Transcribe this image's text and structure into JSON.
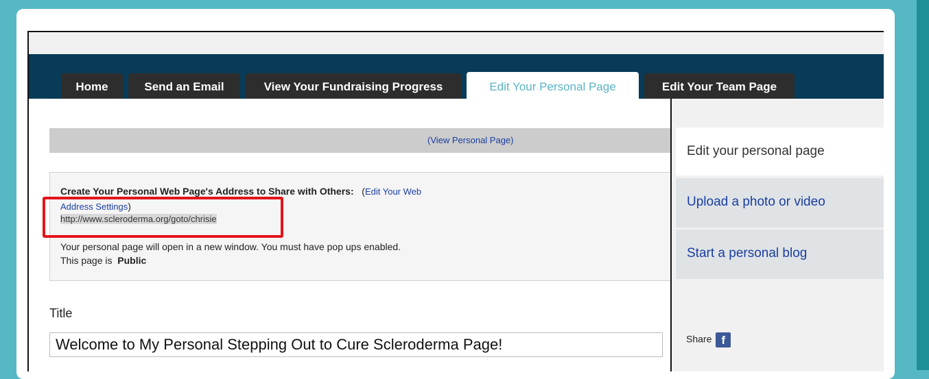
{
  "tabs": [
    {
      "label": "Home"
    },
    {
      "label": "Send an Email"
    },
    {
      "label": "View Your Fundraising Progress"
    },
    {
      "label": "Edit Your Personal Page"
    },
    {
      "label": "Edit Your Team Page"
    }
  ],
  "view_personal_page": "(View Personal Page)",
  "info": {
    "heading": "Create Your Personal Web Page's Address to Share with Others:",
    "paren_open": "(",
    "edit_link_part1": "Edit Your Web",
    "edit_link_part2": "Address Settings",
    "paren_close": ")",
    "url": "http://www.scleroderma.org/goto/chrisie",
    "popup_note": "Your personal page will open in a new window. You must have pop ups enabled.",
    "status_prefix": "This page is",
    "status_value": "Public"
  },
  "title_label": "Title",
  "title_value": "Welcome to My Personal Stepping Out to Cure Scleroderma Page!",
  "side": {
    "current": "Edit your personal page",
    "upload": "Upload a photo or video",
    "blog": "Start a personal blog"
  },
  "share_label": "Share",
  "facebook_glyph": "f",
  "colors": {
    "navbar": "#073b57",
    "active_tab_text": "#5bb4c4",
    "link": "#1a3ea0",
    "highlight": "#e3141b",
    "background": "#56b8c4"
  }
}
